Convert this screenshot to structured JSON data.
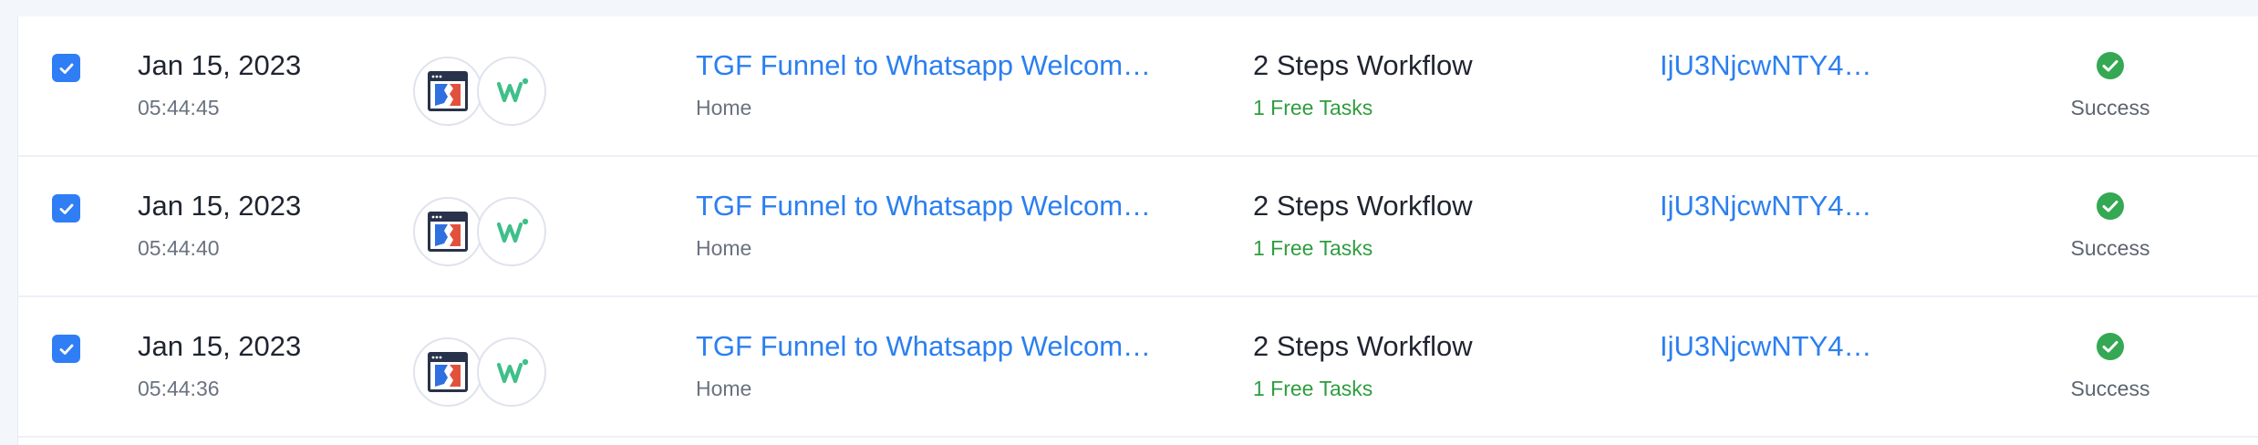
{
  "colors": {
    "accent": "#2f7ef5",
    "link": "#2b7ff0",
    "success": "#34a853",
    "tasks_green": "#2e9d3f"
  },
  "icons": {
    "app_one": "clickfunnels-icon",
    "app_two": "whatsapp-app-icon",
    "status": "check-circle-icon",
    "checkbox": "checkmark-icon"
  },
  "rows": [
    {
      "checked": true,
      "date": "Jan 15, 2023",
      "time": "05:44:45",
      "workflow_title": "TGF Funnel to Whatsapp Welcom…",
      "folder": "Home",
      "steps": "2 Steps Workflow",
      "tasks": "1 Free Tasks",
      "request_id": "IjU3NjcwNTY4…",
      "status": "Success"
    },
    {
      "checked": true,
      "date": "Jan 15, 2023",
      "time": "05:44:40",
      "workflow_title": "TGF Funnel to Whatsapp Welcom…",
      "folder": "Home",
      "steps": "2 Steps Workflow",
      "tasks": "1 Free Tasks",
      "request_id": "IjU3NjcwNTY4…",
      "status": "Success"
    },
    {
      "checked": true,
      "date": "Jan 15, 2023",
      "time": "05:44:36",
      "workflow_title": "TGF Funnel to Whatsapp Welcom…",
      "folder": "Home",
      "steps": "2 Steps Workflow",
      "tasks": "1 Free Tasks",
      "request_id": "IjU3NjcwNTY4…",
      "status": "Success"
    }
  ]
}
